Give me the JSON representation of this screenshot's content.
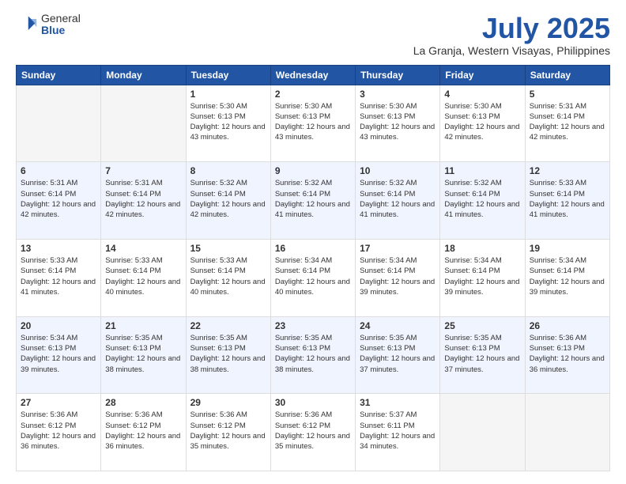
{
  "header": {
    "logo_general": "General",
    "logo_blue": "Blue",
    "month": "July 2025",
    "location": "La Granja, Western Visayas, Philippines"
  },
  "days_of_week": [
    "Sunday",
    "Monday",
    "Tuesday",
    "Wednesday",
    "Thursday",
    "Friday",
    "Saturday"
  ],
  "weeks": [
    [
      {
        "day": "",
        "sunrise": "",
        "sunset": "",
        "daylight": ""
      },
      {
        "day": "",
        "sunrise": "",
        "sunset": "",
        "daylight": ""
      },
      {
        "day": "1",
        "sunrise": "Sunrise: 5:30 AM",
        "sunset": "Sunset: 6:13 PM",
        "daylight": "Daylight: 12 hours and 43 minutes."
      },
      {
        "day": "2",
        "sunrise": "Sunrise: 5:30 AM",
        "sunset": "Sunset: 6:13 PM",
        "daylight": "Daylight: 12 hours and 43 minutes."
      },
      {
        "day": "3",
        "sunrise": "Sunrise: 5:30 AM",
        "sunset": "Sunset: 6:13 PM",
        "daylight": "Daylight: 12 hours and 43 minutes."
      },
      {
        "day": "4",
        "sunrise": "Sunrise: 5:30 AM",
        "sunset": "Sunset: 6:13 PM",
        "daylight": "Daylight: 12 hours and 42 minutes."
      },
      {
        "day": "5",
        "sunrise": "Sunrise: 5:31 AM",
        "sunset": "Sunset: 6:14 PM",
        "daylight": "Daylight: 12 hours and 42 minutes."
      }
    ],
    [
      {
        "day": "6",
        "sunrise": "Sunrise: 5:31 AM",
        "sunset": "Sunset: 6:14 PM",
        "daylight": "Daylight: 12 hours and 42 minutes."
      },
      {
        "day": "7",
        "sunrise": "Sunrise: 5:31 AM",
        "sunset": "Sunset: 6:14 PM",
        "daylight": "Daylight: 12 hours and 42 minutes."
      },
      {
        "day": "8",
        "sunrise": "Sunrise: 5:32 AM",
        "sunset": "Sunset: 6:14 PM",
        "daylight": "Daylight: 12 hours and 42 minutes."
      },
      {
        "day": "9",
        "sunrise": "Sunrise: 5:32 AM",
        "sunset": "Sunset: 6:14 PM",
        "daylight": "Daylight: 12 hours and 41 minutes."
      },
      {
        "day": "10",
        "sunrise": "Sunrise: 5:32 AM",
        "sunset": "Sunset: 6:14 PM",
        "daylight": "Daylight: 12 hours and 41 minutes."
      },
      {
        "day": "11",
        "sunrise": "Sunrise: 5:32 AM",
        "sunset": "Sunset: 6:14 PM",
        "daylight": "Daylight: 12 hours and 41 minutes."
      },
      {
        "day": "12",
        "sunrise": "Sunrise: 5:33 AM",
        "sunset": "Sunset: 6:14 PM",
        "daylight": "Daylight: 12 hours and 41 minutes."
      }
    ],
    [
      {
        "day": "13",
        "sunrise": "Sunrise: 5:33 AM",
        "sunset": "Sunset: 6:14 PM",
        "daylight": "Daylight: 12 hours and 41 minutes."
      },
      {
        "day": "14",
        "sunrise": "Sunrise: 5:33 AM",
        "sunset": "Sunset: 6:14 PM",
        "daylight": "Daylight: 12 hours and 40 minutes."
      },
      {
        "day": "15",
        "sunrise": "Sunrise: 5:33 AM",
        "sunset": "Sunset: 6:14 PM",
        "daylight": "Daylight: 12 hours and 40 minutes."
      },
      {
        "day": "16",
        "sunrise": "Sunrise: 5:34 AM",
        "sunset": "Sunset: 6:14 PM",
        "daylight": "Daylight: 12 hours and 40 minutes."
      },
      {
        "day": "17",
        "sunrise": "Sunrise: 5:34 AM",
        "sunset": "Sunset: 6:14 PM",
        "daylight": "Daylight: 12 hours and 39 minutes."
      },
      {
        "day": "18",
        "sunrise": "Sunrise: 5:34 AM",
        "sunset": "Sunset: 6:14 PM",
        "daylight": "Daylight: 12 hours and 39 minutes."
      },
      {
        "day": "19",
        "sunrise": "Sunrise: 5:34 AM",
        "sunset": "Sunset: 6:14 PM",
        "daylight": "Daylight: 12 hours and 39 minutes."
      }
    ],
    [
      {
        "day": "20",
        "sunrise": "Sunrise: 5:34 AM",
        "sunset": "Sunset: 6:13 PM",
        "daylight": "Daylight: 12 hours and 39 minutes."
      },
      {
        "day": "21",
        "sunrise": "Sunrise: 5:35 AM",
        "sunset": "Sunset: 6:13 PM",
        "daylight": "Daylight: 12 hours and 38 minutes."
      },
      {
        "day": "22",
        "sunrise": "Sunrise: 5:35 AM",
        "sunset": "Sunset: 6:13 PM",
        "daylight": "Daylight: 12 hours and 38 minutes."
      },
      {
        "day": "23",
        "sunrise": "Sunrise: 5:35 AM",
        "sunset": "Sunset: 6:13 PM",
        "daylight": "Daylight: 12 hours and 38 minutes."
      },
      {
        "day": "24",
        "sunrise": "Sunrise: 5:35 AM",
        "sunset": "Sunset: 6:13 PM",
        "daylight": "Daylight: 12 hours and 37 minutes."
      },
      {
        "day": "25",
        "sunrise": "Sunrise: 5:35 AM",
        "sunset": "Sunset: 6:13 PM",
        "daylight": "Daylight: 12 hours and 37 minutes."
      },
      {
        "day": "26",
        "sunrise": "Sunrise: 5:36 AM",
        "sunset": "Sunset: 6:13 PM",
        "daylight": "Daylight: 12 hours and 36 minutes."
      }
    ],
    [
      {
        "day": "27",
        "sunrise": "Sunrise: 5:36 AM",
        "sunset": "Sunset: 6:12 PM",
        "daylight": "Daylight: 12 hours and 36 minutes."
      },
      {
        "day": "28",
        "sunrise": "Sunrise: 5:36 AM",
        "sunset": "Sunset: 6:12 PM",
        "daylight": "Daylight: 12 hours and 36 minutes."
      },
      {
        "day": "29",
        "sunrise": "Sunrise: 5:36 AM",
        "sunset": "Sunset: 6:12 PM",
        "daylight": "Daylight: 12 hours and 35 minutes."
      },
      {
        "day": "30",
        "sunrise": "Sunrise: 5:36 AM",
        "sunset": "Sunset: 6:12 PM",
        "daylight": "Daylight: 12 hours and 35 minutes."
      },
      {
        "day": "31",
        "sunrise": "Sunrise: 5:37 AM",
        "sunset": "Sunset: 6:11 PM",
        "daylight": "Daylight: 12 hours and 34 minutes."
      },
      {
        "day": "",
        "sunrise": "",
        "sunset": "",
        "daylight": ""
      },
      {
        "day": "",
        "sunrise": "",
        "sunset": "",
        "daylight": ""
      }
    ]
  ]
}
